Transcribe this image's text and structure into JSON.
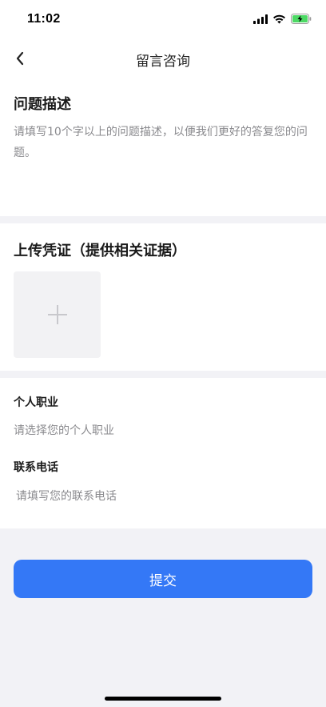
{
  "status_bar": {
    "time": "11:02",
    "icons": [
      "signal-icon",
      "wifi-icon",
      "battery-charging-icon"
    ],
    "battery_color": "#4cd964"
  },
  "nav": {
    "title": "留言咨询",
    "back_icon": "chevron-left-icon"
  },
  "description": {
    "heading": "问题描述",
    "placeholder": "请填写10个字以上的问题描述，以便我们更好的答复您的问题。",
    "value": ""
  },
  "upload": {
    "heading": "上传凭证（提供相关证据）",
    "add_icon": "plus-icon"
  },
  "occupation": {
    "label": "个人职业",
    "placeholder": "请选择您的个人职业"
  },
  "phone": {
    "label": "联系电话",
    "placeholder": "请填写您的联系电话"
  },
  "submit": {
    "label": "提交",
    "color": "#3478f6"
  }
}
